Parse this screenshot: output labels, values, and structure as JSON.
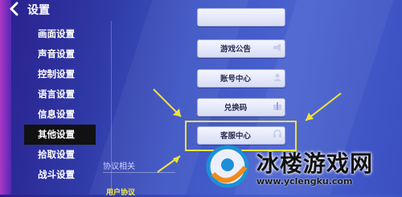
{
  "header": {
    "title": "设置",
    "back_icon": "chevron-left-icon"
  },
  "sidebar": {
    "items": [
      {
        "label": "画面设置"
      },
      {
        "label": "声音设置"
      },
      {
        "label": "控制设置"
      },
      {
        "label": "语言设置"
      },
      {
        "label": "信息设置"
      },
      {
        "label": "其他设置",
        "active": true
      },
      {
        "label": "拾取设置"
      },
      {
        "label": "战斗设置"
      }
    ]
  },
  "content": {
    "buttons": [
      {
        "label": "游戏公告"
      },
      {
        "label": "账号中心"
      },
      {
        "label": "兑换码"
      },
      {
        "label": "客服中心",
        "highlighted": true
      }
    ],
    "section_label": "协议相关",
    "section_link": "用户协议"
  },
  "colors": {
    "highlight": "#f2e23a",
    "arrow": "#f2e23a",
    "active_bg": "#111111"
  },
  "watermark": {
    "title": "冰楼游戏网",
    "url": "www.yclengku.com"
  }
}
